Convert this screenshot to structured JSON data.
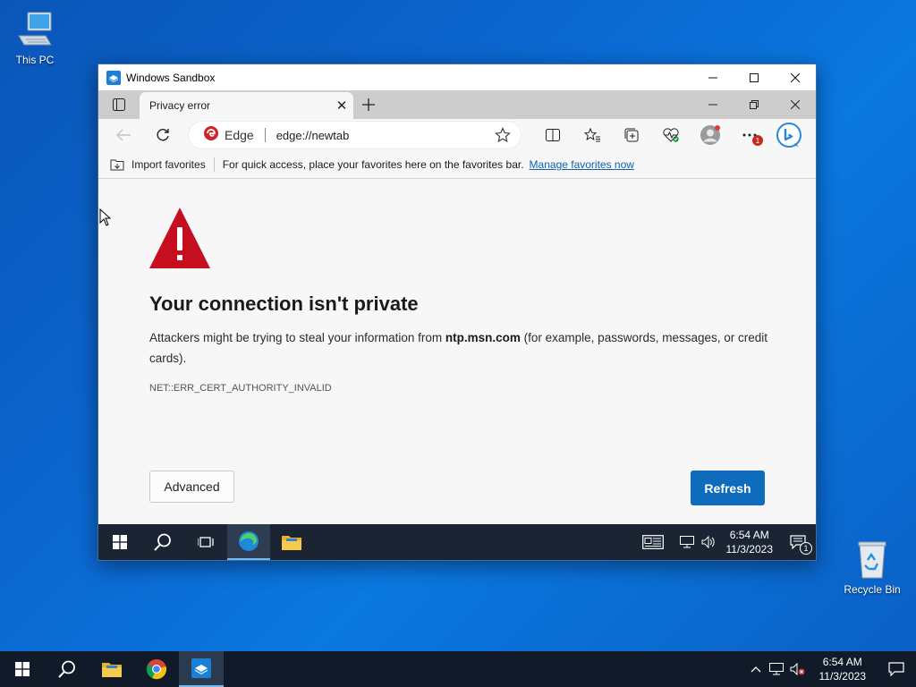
{
  "desktop": {
    "this_pc_label": "This PC",
    "recycle_bin_label": "Recycle Bin"
  },
  "sandbox_window": {
    "title": "Windows Sandbox"
  },
  "browser": {
    "tab_title": "Privacy error",
    "address_brand": "Edge",
    "address_url": "edge://newtab",
    "notification_badge": "1",
    "favorites_bar": {
      "import_label": "Import favorites",
      "message": "For quick access, place your favorites here on the favorites bar.",
      "manage_link": "Manage favorites now"
    }
  },
  "error_page": {
    "title": "Your connection isn't private",
    "desc_before": "Attackers might be trying to steal your information from ",
    "desc_host": "ntp.msn.com",
    "desc_after": " (for example, passwords, messages, or credit cards).",
    "error_code": "NET::ERR_CERT_AUTHORITY_INVALID",
    "advanced_label": "Advanced",
    "refresh_label": "Refresh",
    "warning_color": "#c50f1f",
    "accent_color": "#0f6cbd"
  },
  "sandbox_taskbar": {
    "time": "6:54 AM",
    "date": "11/3/2023",
    "notification_count": "1"
  },
  "host_taskbar": {
    "time": "6:54 AM",
    "date": "11/3/2023"
  }
}
